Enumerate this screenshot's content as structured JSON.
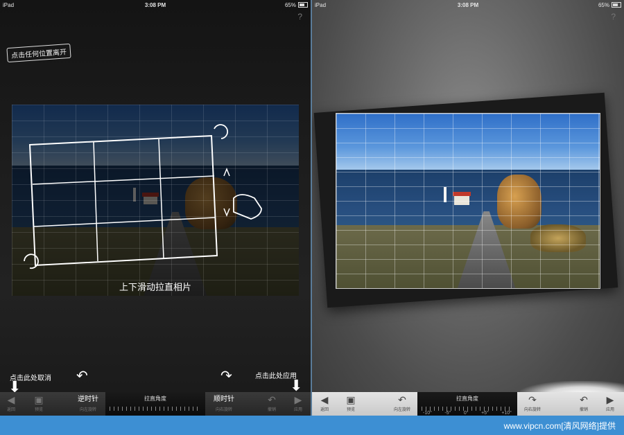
{
  "status": {
    "carrier": "iPad",
    "time": "3:08 PM",
    "battery": "65%"
  },
  "help_label": "?",
  "left": {
    "hint": "点击任何位置离开",
    "gesture_text": "上下滑动拉直相片",
    "cancel_note": "点击此处取消",
    "apply_note": "点击此处应用",
    "ccw_note": "逆时针",
    "cw_note": "顺时针",
    "toolbar": {
      "back": "返回",
      "preview": "预览",
      "rotate_left": "向左旋转",
      "angle_label": "拉直角度",
      "rotate_right": "向右旋转",
      "undo": "撤销",
      "apply": "应用"
    }
  },
  "right": {
    "toolbar": {
      "back": "返回",
      "preview": "预览",
      "rotate_left": "向左旋转",
      "angle_label": "拉直角度",
      "rotate_right": "向右旋转",
      "undo": "撤销",
      "apply": "应用",
      "scale": [
        "-10°",
        "-5°",
        "0°",
        "+5°",
        "+10°"
      ]
    }
  },
  "footer": "www.vipcn.com[清风网络]提供"
}
